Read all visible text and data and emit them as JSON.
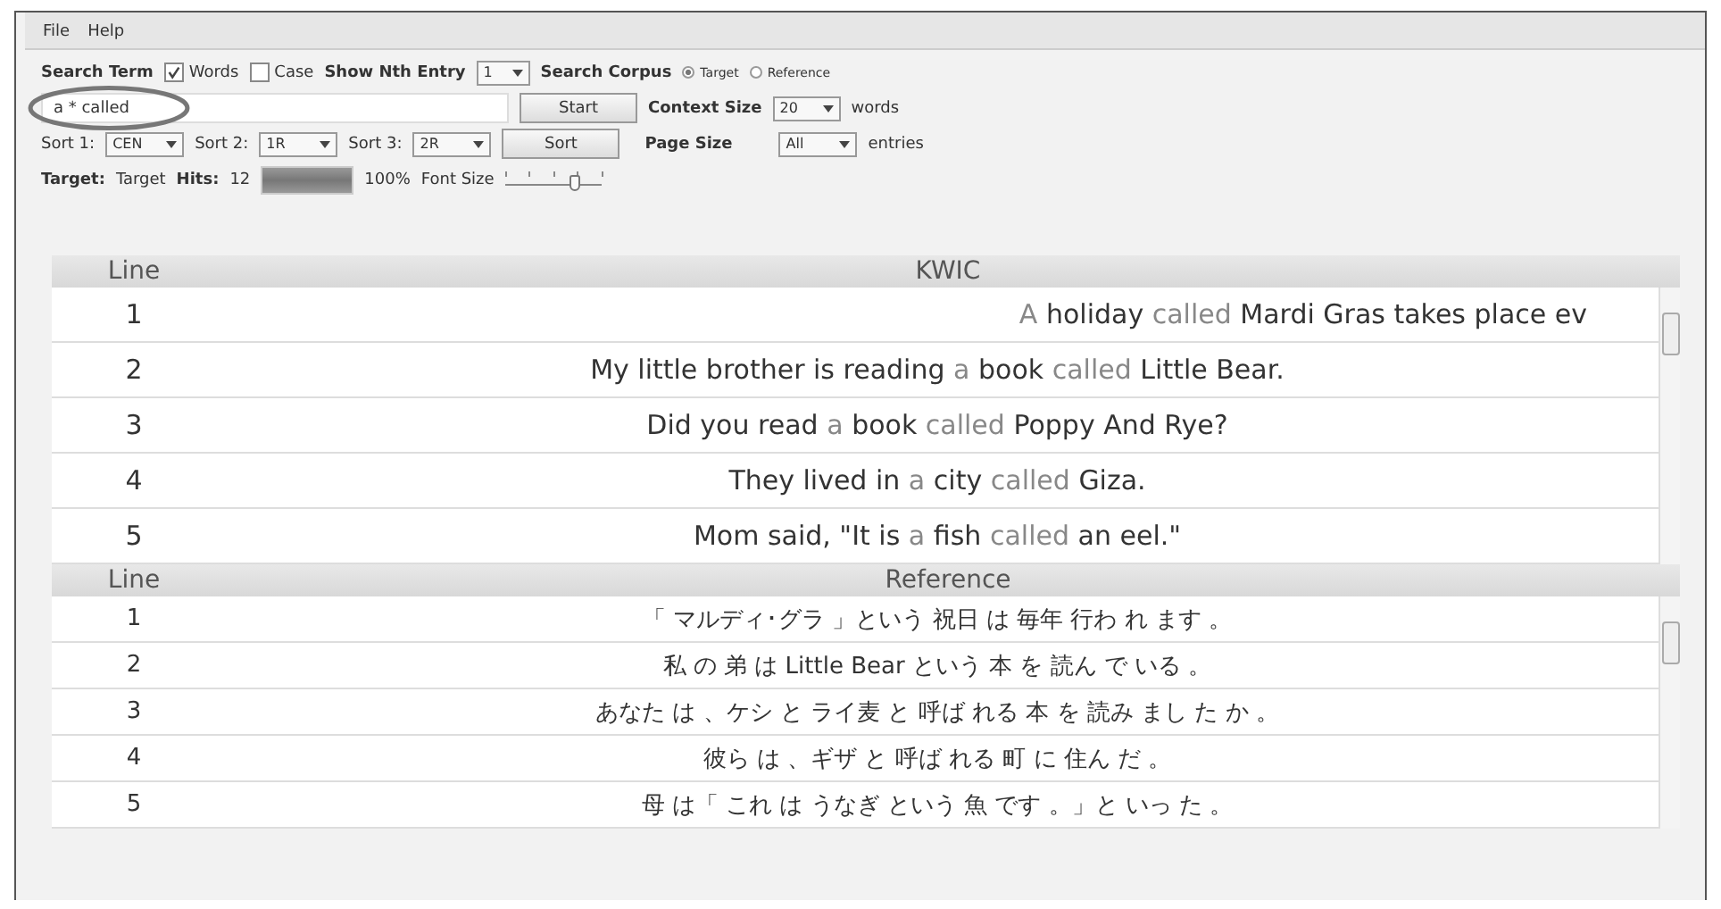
{
  "menu": [
    "File",
    "Help"
  ],
  "search": {
    "label": "Search Term",
    "words": {
      "label": "Words",
      "checked": true
    },
    "case": {
      "label": "Case",
      "checked": false
    },
    "nth_label": "Show Nth Entry",
    "nth_value": "1",
    "corpus_label": "Search Corpus",
    "corpus_options": [
      {
        "label": "Target",
        "selected": true
      },
      {
        "label": "Reference",
        "selected": false
      }
    ]
  },
  "query": {
    "value": "a * called",
    "circled": true,
    "start": "Start",
    "context_label": "Context Size",
    "context_value": "20",
    "context_unit": "words"
  },
  "sorts": [
    {
      "label": "Sort 1:",
      "value": "CEN"
    },
    {
      "label": "Sort 2:",
      "value": "1R"
    },
    {
      "label": "Sort 3:",
      "value": "2R"
    }
  ],
  "sort_button": "Sort",
  "page_size": {
    "label": "Page Size",
    "value": "All",
    "unit": "entries"
  },
  "status": {
    "target_label": "Target:",
    "target_value": "Target",
    "hits_label": "Hits:",
    "hits_value": "12",
    "progress": {
      "level": 1,
      "reading": "100%"
    },
    "font_size": {
      "label": "Font Size",
      "level": 0.72
    }
  },
  "kwic": {
    "columns": [
      "Line",
      "KWIC"
    ],
    "rows": [
      {
        "line": "1",
        "segments": [
          {
            "text": "A",
            "hit": true
          },
          {
            "text": "holiday",
            "hit": false
          },
          {
            "text": "called",
            "hit": true
          },
          {
            "text": "Mardi Gras takes place ev",
            "hit": false
          }
        ]
      },
      {
        "line": "2",
        "segments": [
          {
            "text": "My little brother is reading",
            "hit": false
          },
          {
            "text": "a",
            "hit": true
          },
          {
            "text": "book",
            "hit": false
          },
          {
            "text": "called",
            "hit": true
          },
          {
            "text": "Little Bear.",
            "hit": false
          }
        ]
      },
      {
        "line": "3",
        "segments": [
          {
            "text": "Did you read",
            "hit": false
          },
          {
            "text": "a",
            "hit": true
          },
          {
            "text": "book",
            "hit": false
          },
          {
            "text": "called",
            "hit": true
          },
          {
            "text": "Poppy And Rye?",
            "hit": false
          }
        ]
      },
      {
        "line": "4",
        "segments": [
          {
            "text": "They lived in",
            "hit": false
          },
          {
            "text": "a",
            "hit": true
          },
          {
            "text": "city",
            "hit": false
          },
          {
            "text": "called",
            "hit": true
          },
          {
            "text": "Giza.",
            "hit": false
          }
        ]
      },
      {
        "line": "5",
        "segments": [
          {
            "text": "Mom said, \"It is",
            "hit": false
          },
          {
            "text": "a",
            "hit": true
          },
          {
            "text": "fish",
            "hit": false
          },
          {
            "text": "called",
            "hit": true
          },
          {
            "text": "an eel.\"",
            "hit": false
          }
        ]
      }
    ]
  },
  "reference": {
    "columns": [
      "Line",
      "Reference"
    ],
    "rows": [
      {
        "line": "1",
        "text": "「 マルディ･グラ 」という 祝日 は 毎年 行わ れ ます 。"
      },
      {
        "line": "2",
        "text": "私 の 弟 は Little Bear という 本 を 読ん で いる 。"
      },
      {
        "line": "3",
        "text": "あなた は 、ケシ と ライ麦 と 呼ば れる 本 を 読み まし た か 。"
      },
      {
        "line": "4",
        "text": "彼ら は 、ギザ と 呼ば れる 町 に 住ん だ 。"
      },
      {
        "line": "5",
        "text": "母 は「 これ は うなぎ という 魚 です 。」と いっ た 。"
      }
    ]
  }
}
